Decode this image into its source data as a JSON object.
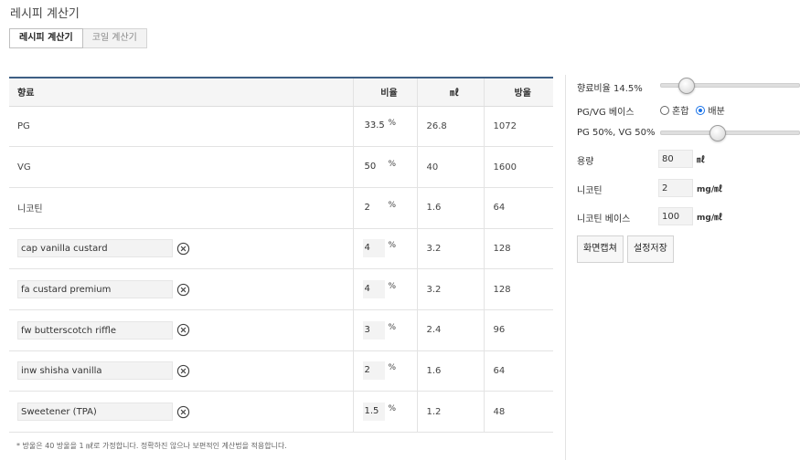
{
  "title": "레시피 계산기",
  "tabs": [
    {
      "label": "레시피 계산기",
      "active": true
    },
    {
      "label": "코일 계산기",
      "active": false
    }
  ],
  "table": {
    "headers": {
      "flavor": "향료",
      "ratio": "비율",
      "ml": "㎖",
      "drops": "방울"
    },
    "pct_symbol": "%",
    "fixed_rows": [
      {
        "name": "PG",
        "ratio": "33.5",
        "ml": "26.8",
        "drops": "1072"
      },
      {
        "name": "VG",
        "ratio": "50",
        "ml": "40",
        "drops": "1600"
      },
      {
        "name": "니코틴",
        "ratio": "2",
        "ml": "1.6",
        "drops": "64"
      }
    ],
    "flavor_rows": [
      {
        "name": "cap vanilla custard",
        "ratio": "4",
        "ml": "3.2",
        "drops": "128"
      },
      {
        "name": "fa custard premium",
        "ratio": "4",
        "ml": "3.2",
        "drops": "128"
      },
      {
        "name": "fw butterscotch riffle",
        "ratio": "3",
        "ml": "2.4",
        "drops": "96"
      },
      {
        "name": "inw shisha vanilla",
        "ratio": "2",
        "ml": "1.6",
        "drops": "64"
      },
      {
        "name": "Sweetener (TPA)",
        "ratio": "1.5",
        "ml": "1.2",
        "drops": "48"
      }
    ]
  },
  "footnote": "* 방울은 40 방울을 1 ㎖로 가정합니다. 정확하진 않으나 보편적인 계산법을 적용합니다.",
  "settings": {
    "flavor_ratio_label": "향료비율 14.5%",
    "flavor_ratio_value_pct": 14.5,
    "pgvg_base_label": "PG/VG 베이스",
    "pgvg_options": [
      {
        "label": "혼합",
        "selected": false
      },
      {
        "label": "배분",
        "selected": true
      }
    ],
    "pgvg_ratio_label": "PG 50%, VG 50%",
    "pg_ratio_value_pct": 50,
    "volume_label": "용량",
    "volume_value": "80",
    "volume_unit": "㎖",
    "nicotine_label": "니코틴",
    "nicotine_value": "2",
    "nicotine_unit": "mg/㎖",
    "nicotine_base_label": "니코틴 베이스",
    "nicotine_base_value": "100",
    "nicotine_base_unit": "mg/㎖"
  },
  "buttons": {
    "capture": "화면캡쳐",
    "save": "설정저장"
  },
  "colors": {
    "header_accent": "#3e5f84",
    "radio_selected": "#1a73e8"
  }
}
